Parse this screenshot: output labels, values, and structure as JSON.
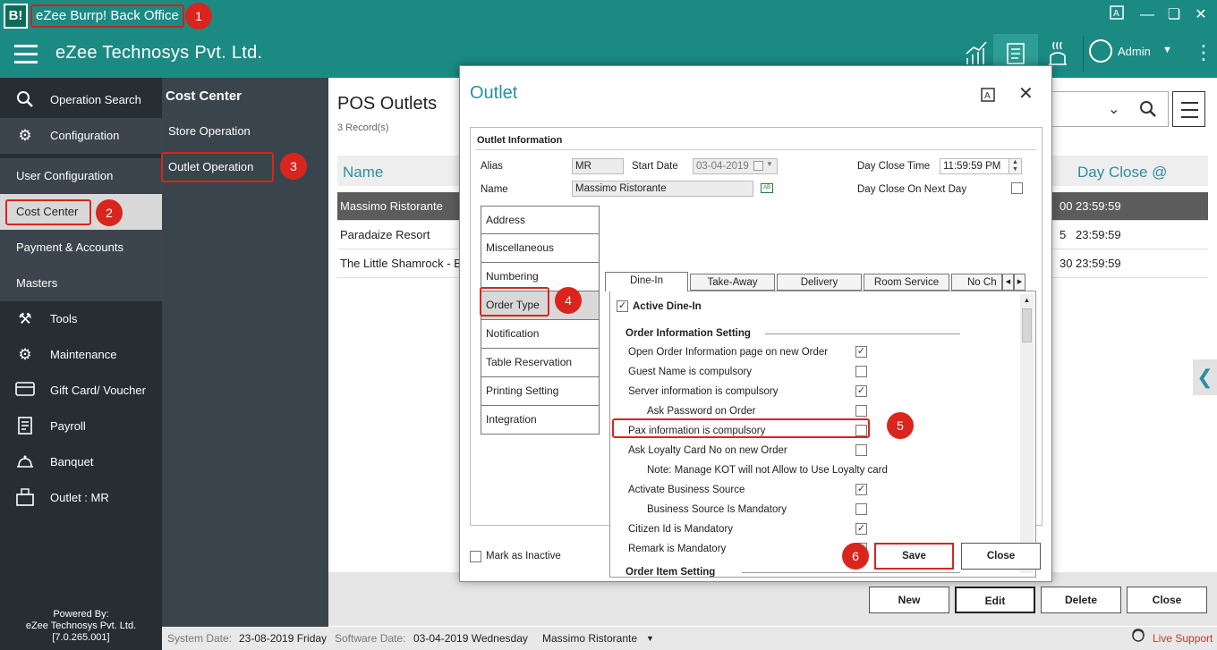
{
  "app": {
    "title": "eZee Burrp! Back Office",
    "logo_text": "B!",
    "company": "eZee Technosys Pvt. Ltd.",
    "admin_label": "Admin"
  },
  "colors": {
    "header": "#1a8a83",
    "sidebar": "#262d33",
    "sidebar_secondary": "#3a444c",
    "accent": "#2a8fa0",
    "annotation": "#d9251d"
  },
  "sidebar": {
    "items": [
      {
        "label": "Operation Search",
        "icon": "search-icon"
      },
      {
        "label": "Configuration",
        "icon": "gear-icon"
      },
      {
        "label": "User Configuration"
      },
      {
        "label": "Cost Center"
      },
      {
        "label": "Payment & Accounts"
      },
      {
        "label": "Masters"
      },
      {
        "label": "Tools",
        "icon": "tools-icon"
      },
      {
        "label": "Maintenance",
        "icon": "maintenance-icon"
      },
      {
        "label": "Gift Card/ Voucher",
        "icon": "gift-card-icon"
      },
      {
        "label": "Payroll",
        "icon": "payroll-icon"
      },
      {
        "label": "Banquet",
        "icon": "banquet-icon"
      },
      {
        "label": "Outlet : MR",
        "icon": "outlet-icon"
      }
    ],
    "powered_by": [
      "Powered By:",
      "eZee Technosys Pvt. Ltd.",
      "[7.0.265.001]"
    ]
  },
  "subnav": {
    "title": "Cost Center",
    "items": [
      "Store Operation",
      "Outlet Operation"
    ]
  },
  "annotations": [
    "1",
    "2",
    "3",
    "4",
    "5",
    "6"
  ],
  "main": {
    "title": "POS Outlets",
    "record_count": "3 Record(s)",
    "columns": [
      "Name",
      "Day Close @"
    ],
    "rows": [
      {
        "name": "Massimo Ristorante",
        "fragment": "00",
        "day_close": "23:59:59"
      },
      {
        "name": "Paradaize Resort",
        "fragment": "5",
        "day_close": "23:59:59"
      },
      {
        "name": "The Little Shamrock - B",
        "fragment": "30",
        "day_close": "23:59:59"
      }
    ],
    "buttons": [
      "New",
      "Edit",
      "Delete",
      "Close"
    ]
  },
  "status_bar": {
    "system_date_label": "System Date:",
    "system_date": "23-08-2019 Friday",
    "software_date_label": "Software Date:",
    "software_date": "03-04-2019 Wednesday",
    "outlet": "Massimo Ristorante",
    "live_support": "Live Support"
  },
  "dialog": {
    "title": "Outlet",
    "section_title": "Outlet Information",
    "alias_label": "Alias",
    "alias_value": "MR",
    "start_date_label": "Start Date",
    "start_date_value": "03-04-2019",
    "day_close_time_label": "Day Close Time",
    "day_close_time_value": "11:59:59 PM",
    "name_label": "Name",
    "name_value": "Massimo Ristorante",
    "day_close_next_day_label": "Day Close On Next Day",
    "vertical_tabs": [
      "Address",
      "Miscellaneous",
      "Numbering",
      "Order Type",
      "Notification",
      "Table Reservation",
      "Printing Setting",
      "Integration"
    ],
    "horizontal_tabs": [
      "Dine-In",
      "Take-Away",
      "Delivery",
      "Room Service",
      "No Ch"
    ],
    "active_dine_in_label": "Active Dine-In",
    "order_info_title": "Order Information Setting",
    "options": [
      {
        "label": "Open Order Information page on new Order",
        "checked": true
      },
      {
        "label": "Guest Name is compulsory",
        "checked": false
      },
      {
        "label": "Server information is compulsory",
        "checked": true
      },
      {
        "label": "Ask Password on Order",
        "checked": false
      },
      {
        "label": "Pax information is compulsory",
        "checked": false
      },
      {
        "label": "Ask Loyalty Card No on new Order",
        "checked": false
      },
      {
        "label": "Note: Manage KOT will not Allow to Use Loyalty card"
      },
      {
        "label": "Activate Business Source",
        "checked": true
      },
      {
        "label": "Business Source Is Mandatory",
        "checked": false
      },
      {
        "label": "Citizen Id is Mandatory",
        "checked": true
      },
      {
        "label": "Remark is Mandatory",
        "checked": false
      }
    ],
    "order_item_title": "Order Item Setting",
    "mark_inactive_label": "Mark as Inactive",
    "save_label": "Save",
    "close_label": "Close"
  }
}
